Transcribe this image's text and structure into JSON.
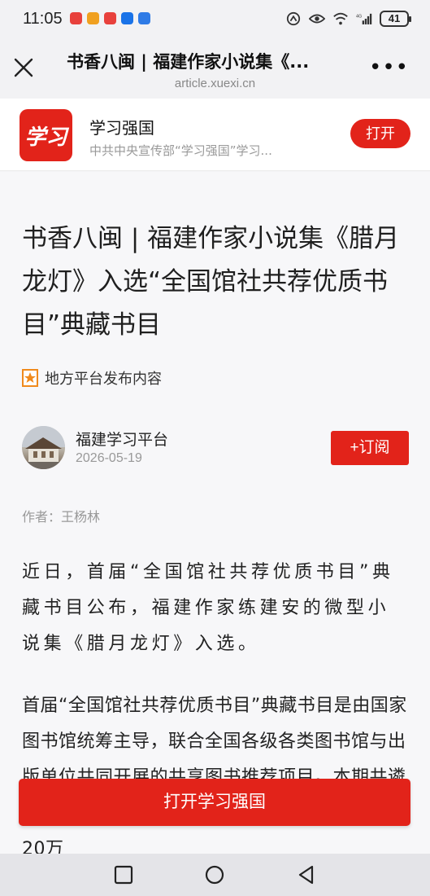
{
  "status_bar": {
    "time": "11:05",
    "battery": "41",
    "app_icon_colors": [
      "#e8413c",
      "#f0a020",
      "#e8413c",
      "#1a73e8",
      "#2f7be6"
    ],
    "icons": [
      "nfc-icon",
      "eye-comfort-icon",
      "wifi-icon",
      "signal-4g-icon",
      "battery-icon"
    ]
  },
  "browser": {
    "title": "书香八闽 | 福建作家小说集《...",
    "url": "article.xuexi.cn"
  },
  "app_banner": {
    "logo_text": "学习",
    "name": "学习强国",
    "description": "中共中央宣传部“学习强国”学习...",
    "open_label": "打开"
  },
  "article": {
    "headline": "书香八闽 | 福建作家小说集《腊月龙灯》入选“全国馆社共荐优质书目”典藏书目",
    "platform_label": "地方平台发布内容",
    "source_name": "福建学习平台",
    "date": "2026-05-19",
    "subscribe_label": "+订阅",
    "author": "作者：王杨林",
    "paragraphs": [
      "近日，首届“全国馆社共荐优质书目”典藏书目公布，福建作家练建安的微型小说集《腊月龙灯》入选。",
      "首届“全国馆社共荐优质书目”典藏书目是由国家图书馆统筹主导，联合全国各级各类图书馆与出版单位共同开展的共享图书推荐项目。本期共遴选约182家出版单位参加，从2025年出版的近20万"
    ]
  },
  "cta": {
    "label": "打开学习强国"
  },
  "colors": {
    "brand_red": "#e2231a",
    "background": "#f7f7f9"
  }
}
